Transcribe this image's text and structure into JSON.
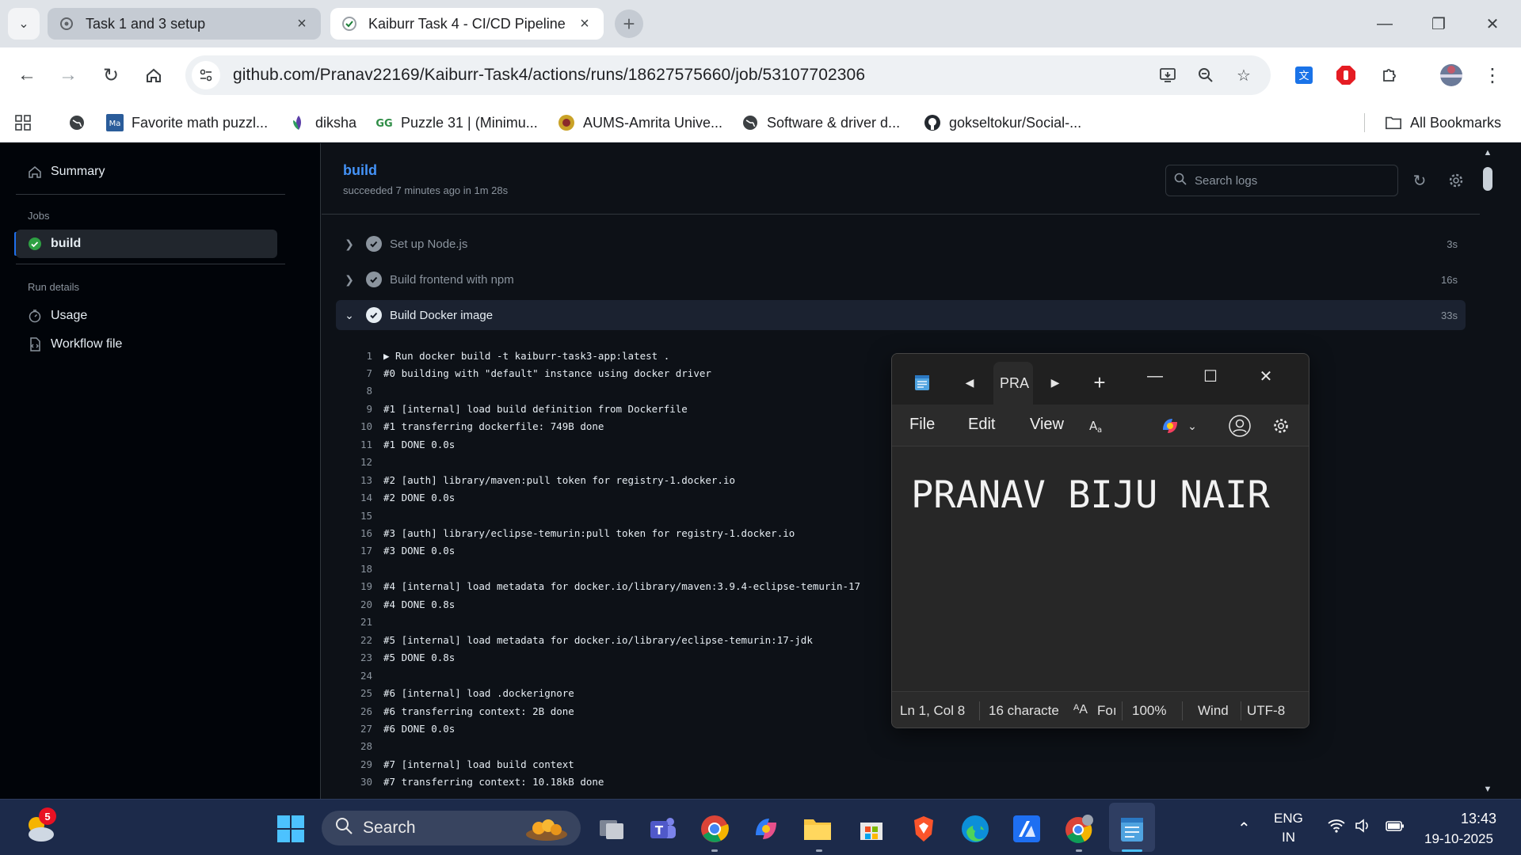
{
  "browser": {
    "tabs": [
      {
        "title": "Task 1 and 3 setup"
      },
      {
        "title": "Kaiburr Task 4 - CI/CD Pipeline"
      }
    ],
    "url": "github.com/Pranav22169/Kaiburr-Task4/actions/runs/18627575660/job/53107702306",
    "bookmarks": [
      {
        "label": "Favorite math puzzl..."
      },
      {
        "label": "diksha"
      },
      {
        "label": "Puzzle 31 | (Minimu..."
      },
      {
        "label": "AUMS-Amrita Unive..."
      },
      {
        "label": "Software & driver d..."
      },
      {
        "label": "gokseltokur/Social-..."
      }
    ],
    "all_bookmarks": "All Bookmarks"
  },
  "sidebar": {
    "summary": "Summary",
    "jobs_label": "Jobs",
    "job_build": "build",
    "run_details_label": "Run details",
    "usage": "Usage",
    "workflow_file": "Workflow file"
  },
  "job": {
    "title": "build",
    "subtitle": "succeeded 7 minutes ago in 1m 28s",
    "search_placeholder": "Search logs"
  },
  "steps": [
    {
      "name": "Set up Node.js",
      "duration": "3s"
    },
    {
      "name": "Build frontend with npm",
      "duration": "16s"
    },
    {
      "name": "Build Docker image",
      "duration": "33s"
    }
  ],
  "log_lines": [
    {
      "n": "1",
      "t": "▶ Run docker build -t kaiburr-task3-app:latest ."
    },
    {
      "n": "7",
      "t": "#0 building with \"default\" instance using docker driver"
    },
    {
      "n": "8",
      "t": ""
    },
    {
      "n": "9",
      "t": "#1 [internal] load build definition from Dockerfile"
    },
    {
      "n": "10",
      "t": "#1 transferring dockerfile: 749B done"
    },
    {
      "n": "11",
      "t": "#1 DONE 0.0s"
    },
    {
      "n": "12",
      "t": ""
    },
    {
      "n": "13",
      "t": "#2 [auth] library/maven:pull token for registry-1.docker.io"
    },
    {
      "n": "14",
      "t": "#2 DONE 0.0s"
    },
    {
      "n": "15",
      "t": ""
    },
    {
      "n": "16",
      "t": "#3 [auth] library/eclipse-temurin:pull token for registry-1.docker.io"
    },
    {
      "n": "17",
      "t": "#3 DONE 0.0s"
    },
    {
      "n": "18",
      "t": ""
    },
    {
      "n": "19",
      "t": "#4 [internal] load metadata for docker.io/library/maven:3.9.4-eclipse-temurin-17"
    },
    {
      "n": "20",
      "t": "#4 DONE 0.8s"
    },
    {
      "n": "21",
      "t": ""
    },
    {
      "n": "22",
      "t": "#5 [internal] load metadata for docker.io/library/eclipse-temurin:17-jdk"
    },
    {
      "n": "23",
      "t": "#5 DONE 0.8s"
    },
    {
      "n": "24",
      "t": ""
    },
    {
      "n": "25",
      "t": "#6 [internal] load .dockerignore"
    },
    {
      "n": "26",
      "t": "#6 transferring context: 2B done"
    },
    {
      "n": "27",
      "t": "#6 DONE 0.0s"
    },
    {
      "n": "28",
      "t": ""
    },
    {
      "n": "29",
      "t": "#7 [internal] load build context"
    },
    {
      "n": "30",
      "t": "#7 transferring context: 10.18kB done"
    }
  ],
  "notepad": {
    "tab_title": "PRA",
    "menu": {
      "file": "File",
      "edit": "Edit",
      "view": "View"
    },
    "content": "PRANAV BIJU NAIR",
    "status": {
      "position": "Ln 1, Col 8",
      "chars": "16 characte",
      "font": "Foı",
      "zoom": "100%",
      "line_ending": "Wind",
      "encoding": "UTF-8"
    }
  },
  "taskbar": {
    "weather_badge": "5",
    "search_placeholder": "Search",
    "lang_top": "ENG",
    "lang_bottom": "IN",
    "time": "13:43",
    "date": "19-10-2025"
  },
  "colors": {
    "accent_blue": "#4493f8",
    "github_bg": "#0d1117",
    "success_green": "#2ea043"
  }
}
